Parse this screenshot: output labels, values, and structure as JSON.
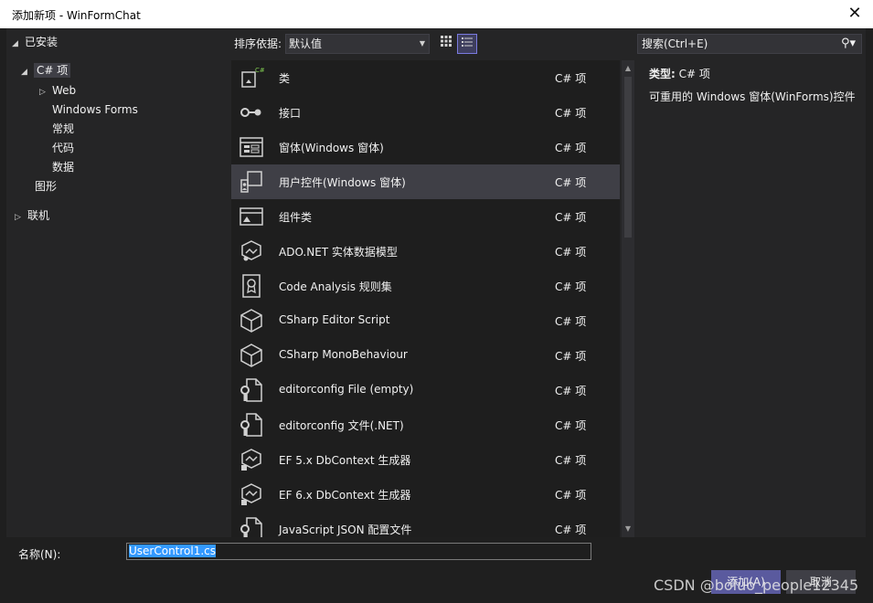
{
  "window": {
    "title": "添加新项 - WinFormChat",
    "close_glyph": "✕"
  },
  "tree": {
    "installed": "已安装",
    "csharp": "C# 项",
    "web": "Web",
    "windows_forms": "Windows Forms",
    "general": "常规",
    "code": "代码",
    "data": "数据",
    "graphics": "图形",
    "online": "联机"
  },
  "toolbar": {
    "sort_label": "排序依据:",
    "sort_value": "默认值"
  },
  "search": {
    "placeholder": "搜索(Ctrl+E)"
  },
  "templates": [
    {
      "name": "类",
      "lang": "C# 项",
      "icon": "class-icon"
    },
    {
      "name": "接口",
      "lang": "C# 项",
      "icon": "interface-icon"
    },
    {
      "name": "窗体(Windows 窗体)",
      "lang": "C# 项",
      "icon": "form-icon"
    },
    {
      "name": "用户控件(Windows 窗体)",
      "lang": "C# 项",
      "icon": "user-control-icon",
      "selected": true
    },
    {
      "name": "组件类",
      "lang": "C# 项",
      "icon": "component-icon"
    },
    {
      "name": "ADO.NET 实体数据模型",
      "lang": "C# 项",
      "icon": "entity-model-icon"
    },
    {
      "name": "Code Analysis 规则集",
      "lang": "C# 项",
      "icon": "ruleset-icon"
    },
    {
      "name": "CSharp Editor Script",
      "lang": "C# 项",
      "icon": "cube-icon"
    },
    {
      "name": "CSharp MonoBehaviour",
      "lang": "C# 项",
      "icon": "cube-icon"
    },
    {
      "name": "editorconfig File (empty)",
      "lang": "C# 项",
      "icon": "wrench-file-icon"
    },
    {
      "name": "editorconfig 文件(.NET)",
      "lang": "C# 项",
      "icon": "wrench-file-icon"
    },
    {
      "name": "EF 5.x DbContext 生成器",
      "lang": "C# 项",
      "icon": "dbcontext-icon"
    },
    {
      "name": "EF 6.x DbContext 生成器",
      "lang": "C# 项",
      "icon": "dbcontext-icon"
    },
    {
      "name": "JavaScript JSON 配置文件",
      "lang": "C# 项",
      "icon": "wrench-file-icon"
    }
  ],
  "details": {
    "type_label": "类型:",
    "type_value": "C# 项",
    "description": "可重用的 Windows 窗体(WinForms)控件"
  },
  "bottom": {
    "name_label": "名称(N):",
    "name_value": "UserControl1.cs",
    "add_button": "添加(A)",
    "cancel_button": "取消"
  },
  "watermark": "CSDN @boluo_people12345",
  "colors": {
    "accent": "#5a5a9e",
    "selection": "#3399ff",
    "background": "#252526"
  }
}
